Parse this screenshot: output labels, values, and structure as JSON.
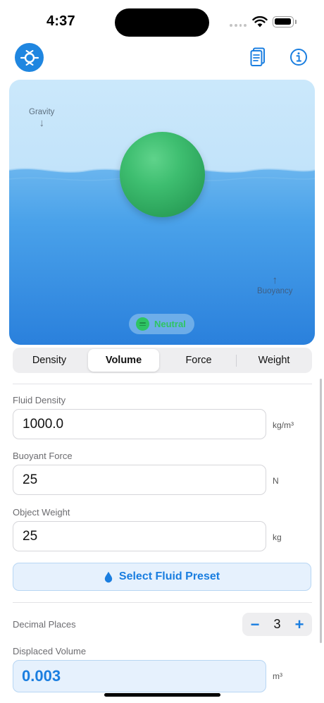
{
  "status_bar": {
    "time": "4:37"
  },
  "header": {
    "logo_icon": "buoyancy-logo-icon",
    "guide_icon": "guide-book-icon",
    "info_icon": "info-icon"
  },
  "scene": {
    "gravity_label": "Gravity",
    "buoyancy_label": "Buoyancy",
    "status_label": "Neutral",
    "status_color": "#2ec464",
    "ball_color": "#3ebe70",
    "water_color": "#3a94e6"
  },
  "tabs": {
    "items": [
      "Density",
      "Volume",
      "Force",
      "Weight"
    ],
    "selected": "Volume"
  },
  "fields": {
    "fluid_density": {
      "label": "Fluid Density",
      "value": "1000.0",
      "unit": "kg/m³"
    },
    "buoyant_force": {
      "label": "Buoyant Force",
      "value": "25",
      "unit": "N"
    },
    "object_weight": {
      "label": "Object Weight",
      "value": "25",
      "unit": "kg"
    }
  },
  "preset_button": {
    "label": "Select Fluid Preset",
    "icon": "water-drop-icon"
  },
  "decimal_places": {
    "label": "Decimal Places",
    "value": "3",
    "minus": "−",
    "plus": "+"
  },
  "result": {
    "label": "Displaced Volume",
    "value": "0.003",
    "unit": "m³"
  },
  "colors": {
    "accent": "#1a7ee0",
    "field_border": "#d6d6da",
    "result_bg": "#e6f1fd"
  }
}
